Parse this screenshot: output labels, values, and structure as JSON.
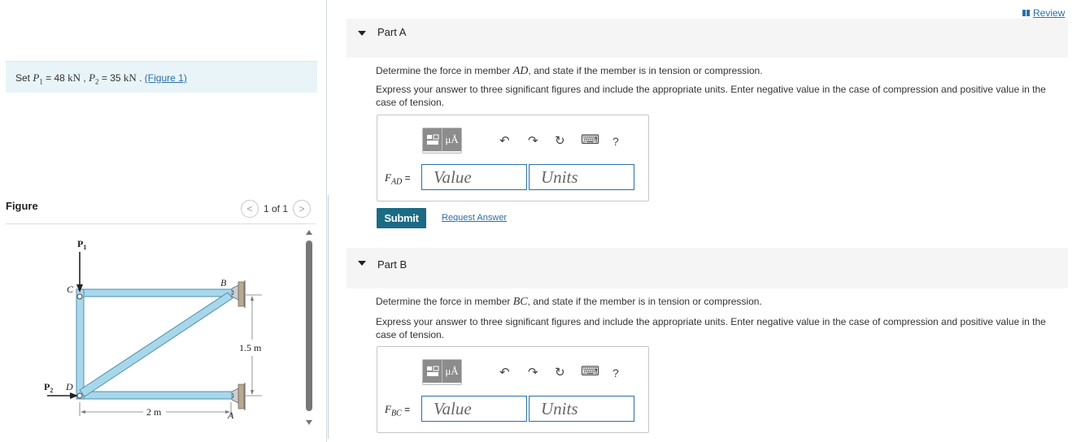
{
  "review": {
    "label": "Review"
  },
  "problem": {
    "prefix": "Set ",
    "p1_sym": "P",
    "p1_sub": "1",
    "p1_val": " = 48 ",
    "p1_unit": "kN",
    "sep": " , ",
    "p2_sym": "P",
    "p2_sub": "2",
    "p2_val": " = 35 ",
    "p2_unit": "kN",
    "dot": " . ",
    "figure_link": "(Figure 1)"
  },
  "figure": {
    "label": "Figure",
    "pager": "1 of 1",
    "prev": "<",
    "next": ">",
    "labels": {
      "p1": "P",
      "p1_sub": "1",
      "p2": "P",
      "p2_sub": "2",
      "c": "C",
      "b": "B",
      "d": "D",
      "a": "A",
      "height": "1.5 m",
      "width": "2 m"
    },
    "colors": {
      "member": "#a9d7ea",
      "member_edge": "#4a8fb0",
      "support": "#b7a992"
    }
  },
  "partA": {
    "title": "Part A",
    "question_pre": "Determine the force in member ",
    "member": "AD",
    "question_post": ", and state if the member is in tension or compression.",
    "instructions": "Express your answer to three significant figures and include the appropriate units. Enter negative value in the case of compression and positive value in the case of tension.",
    "var_main": "F",
    "var_sub": "AD",
    "eq": " =",
    "value_placeholder": "Value",
    "units_placeholder": "Units",
    "submit": "Submit",
    "request": "Request Answer"
  },
  "partB": {
    "title": "Part B",
    "question_pre": "Determine the force in member ",
    "member": "BC",
    "question_post": ", and state if the member is in tension or compression.",
    "instructions": "Express your answer to three significant figures and include the appropriate units. Enter negative value in the case of compression and positive value in the case of tension.",
    "var_main": "F",
    "var_sub": "BC",
    "eq": " =",
    "value_placeholder": "Value",
    "units_placeholder": "Units"
  },
  "toolbar": {
    "mu_label": "μÅ",
    "undo_icon": "↶",
    "redo_icon": "↷",
    "reset_icon": "↻",
    "keyboard_icon": "⌨",
    "help": "?"
  },
  "colors": {
    "accent": "#1b6b84",
    "link": "#2a6fa8",
    "problem_bg": "#e8f4f8"
  }
}
